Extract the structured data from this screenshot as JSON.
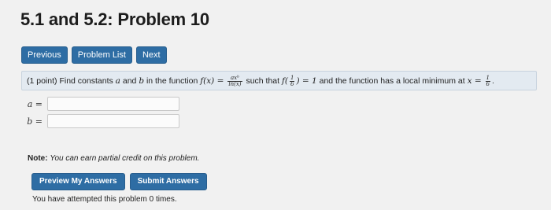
{
  "page": {
    "title": "5.1 and 5.2: Problem 10"
  },
  "nav": {
    "previous": "Previous",
    "problem_list": "Problem List",
    "next": "Next"
  },
  "problem": {
    "points": "(1 point)",
    "text_1": "Find constants",
    "var_a": "a",
    "and": "and",
    "var_b": "b",
    "text_2": "in the function",
    "fx": "f(x) =",
    "frac_num": "axᵇ",
    "frac_den": "ln(x)",
    "text_3": "such that",
    "f_open": "f(",
    "half_num": "1",
    "half_den": "6",
    "f_close": ") = 1",
    "text_4": "and the function has a local minimum at",
    "x_eq": "x =",
    "min_num": "1",
    "min_den": "6",
    "period": "."
  },
  "answers": {
    "a_label": "a =",
    "a_value": "",
    "b_label": "b =",
    "b_value": ""
  },
  "note": {
    "label": "Note:",
    "text": "You can earn partial credit on this problem."
  },
  "actions": {
    "preview": "Preview My Answers",
    "submit": "Submit Answers"
  },
  "status": {
    "attempts": "You have attempted this problem 0 times."
  }
}
